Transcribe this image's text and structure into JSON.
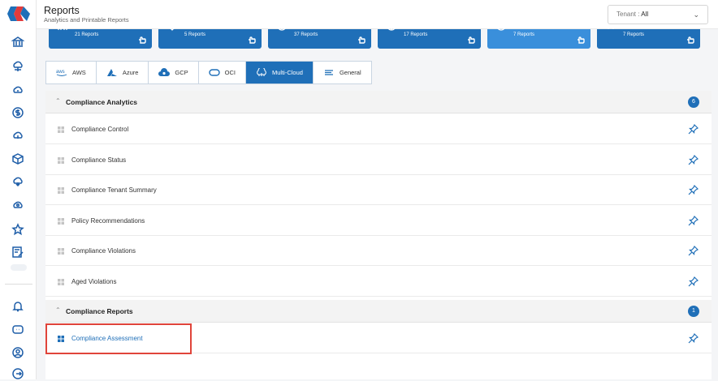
{
  "header": {
    "title": "Reports",
    "subtitle": "Analytics and Printable Reports"
  },
  "tenant": {
    "label": "Tenant : ",
    "value": "All"
  },
  "cards": [
    {
      "count": "21 Reports",
      "style": "dark"
    },
    {
      "count": "5 Reports",
      "style": "dark"
    },
    {
      "count": "37 Reports",
      "style": "dark"
    },
    {
      "count": "17 Reports",
      "style": "dark"
    },
    {
      "count": "7 Reports",
      "style": "light"
    },
    {
      "count": "7 Reports",
      "style": "dark"
    }
  ],
  "tabs": [
    {
      "label": "AWS",
      "icon": "aws-icon"
    },
    {
      "label": "Azure",
      "icon": "azure-icon"
    },
    {
      "label": "GCP",
      "icon": "gcp-icon"
    },
    {
      "label": "OCI",
      "icon": "oci-icon"
    },
    {
      "label": "Multi-Cloud",
      "icon": "multicloud-icon",
      "active": true
    },
    {
      "label": "General",
      "icon": "general-icon"
    }
  ],
  "groups": [
    {
      "label": "Compliance Analytics",
      "count": "6",
      "items": [
        "Compliance Control",
        "Compliance Status",
        "Compliance Tenant Summary",
        "Policy Recommendations",
        "Compliance Violations",
        "Aged Violations"
      ]
    },
    {
      "label": "Compliance Reports",
      "count": "1",
      "items": [
        "Compliance Assessment"
      ]
    }
  ],
  "colors": {
    "accent": "#1f6fb8",
    "highlight": "#e0443a"
  }
}
